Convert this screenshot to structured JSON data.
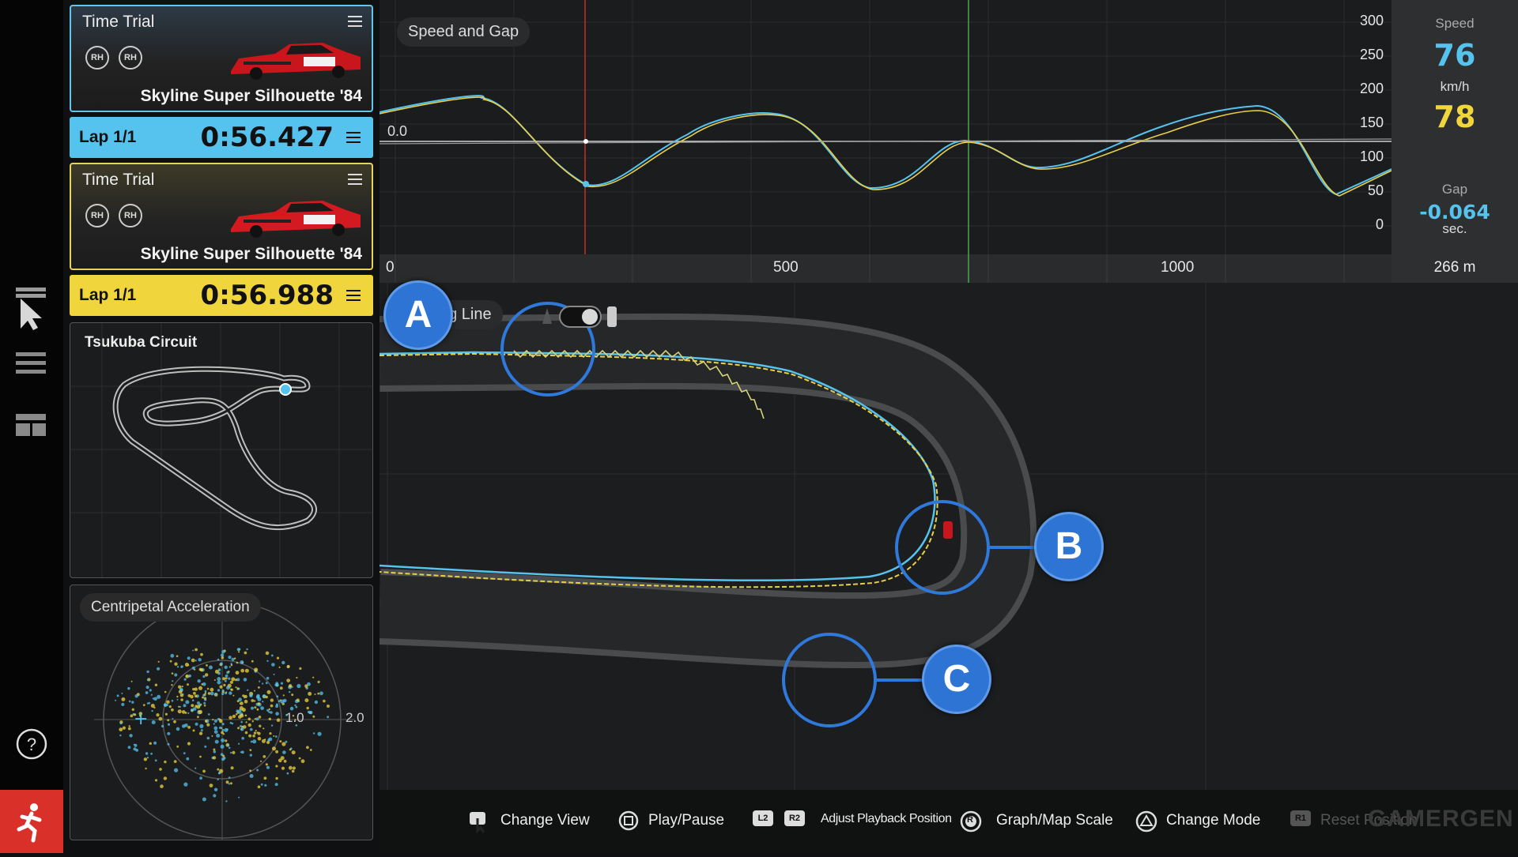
{
  "top_card": {
    "title": "Time Trial",
    "tires": [
      "RH",
      "RH"
    ],
    "car": "Skyline Super Silhouette '84"
  },
  "top_lap": {
    "label": "Lap 1/1",
    "time": "0:56.427"
  },
  "bottom_card": {
    "title": "Time Trial",
    "tires": [
      "RH",
      "RH"
    ],
    "car": "Skyline Super Silhouette '84"
  },
  "bottom_lap": {
    "label": "Lap 1/1",
    "time": "0:56.988"
  },
  "track_map": {
    "title": "Tsukuba Circuit"
  },
  "accel": {
    "title": "Centripetal Acceleration",
    "ring_labels": [
      "1.0",
      "2.0"
    ]
  },
  "graph": {
    "title": "Speed and Gap",
    "zero_label": "0.0",
    "y_ticks": [
      "300",
      "250",
      "200",
      "150",
      "100",
      "50",
      "0"
    ],
    "x_ticks": [
      "0",
      "500",
      "1000"
    ]
  },
  "readout": {
    "speed_label": "Speed",
    "speed_blue": "76",
    "speed_unit": "km/h",
    "speed_yellow": "78",
    "gap_label": "Gap",
    "gap_value": "-0.064",
    "gap_unit": "sec.",
    "distance": "266 m"
  },
  "map": {
    "driving_line_label": "Driving Line",
    "markers": [
      "A",
      "B",
      "C"
    ]
  },
  "controls": [
    {
      "label": "Change View",
      "icon": "touchpad-icon"
    },
    {
      "label": "Play/Pause",
      "icon": "square-button-icon"
    },
    {
      "label": "Adjust Playback Position",
      "icon": "l2-r2-icon",
      "keys": [
        "L2",
        "R2"
      ]
    },
    {
      "label": "Graph/Map Scale",
      "icon": "r-stick-icon",
      "key": "R"
    },
    {
      "label": "Change Mode",
      "icon": "triangle-button-icon"
    },
    {
      "label": "Reset Position",
      "icon": "r1-icon",
      "key": "R1"
    }
  ],
  "watermark": "GAMERGEN",
  "colors": {
    "blue": "#56c3ef",
    "yellow": "#f0d63c",
    "marker": "#2d74d4",
    "exit": "#d9302a"
  }
}
